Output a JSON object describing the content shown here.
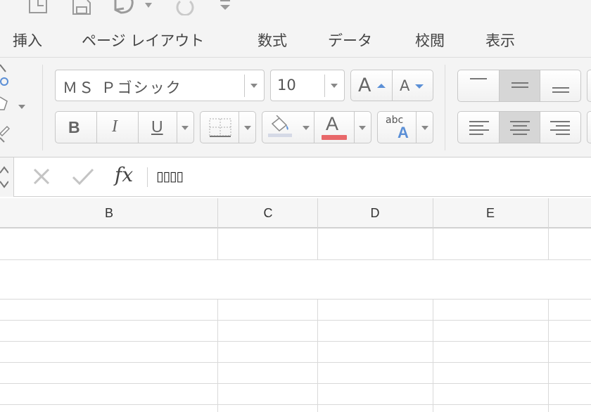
{
  "ribbon_tabs": [
    "挿入",
    "ページ レイアウト",
    "数式",
    "データ",
    "校閲",
    "表示"
  ],
  "font": {
    "name": "ＭＳ Ｐゴシック",
    "size": "10"
  },
  "format_buttons": {
    "bold": "B",
    "italic": "I",
    "underline": "U",
    "font_color_glyph": "A",
    "grow_font_glyph": "A",
    "shrink_font_glyph": "A",
    "abc_label": "abc",
    "abc_glyph": "A"
  },
  "colors": {
    "font_color_swatch": "#e8686a",
    "fill_color_swatch": "#d5d9e6",
    "accent_blue": "#5b8fd6"
  },
  "formula_bar": {
    "fx_label": "fx",
    "content": "▯▯▯▯"
  },
  "columns": [
    "B",
    "C",
    "D",
    "E"
  ],
  "icons": [
    "file-icon",
    "save-icon",
    "undo-icon",
    "redo-icon",
    "customize-toolbar-icon",
    "cut-icon",
    "copy-icon",
    "format-painter-icon",
    "borders-icon",
    "fill-color-icon",
    "cancel-icon",
    "enter-icon",
    "align-top-icon",
    "align-middle-icon",
    "align-bottom-icon",
    "align-left-icon",
    "align-center-icon",
    "align-right-icon"
  ]
}
